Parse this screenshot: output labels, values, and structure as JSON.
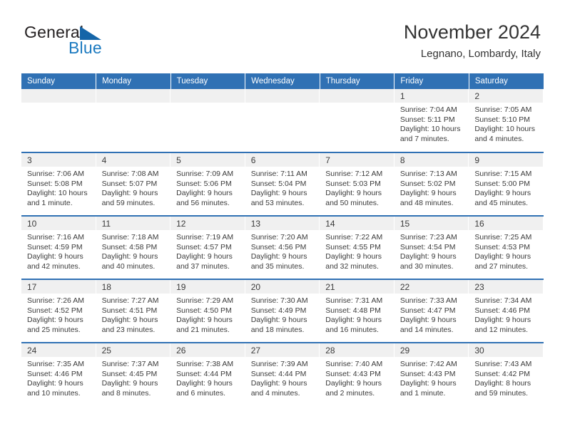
{
  "brand": {
    "name_part1": "General",
    "name_part2": "Blue",
    "triangle_icon": "triangle-icon",
    "accent_color": "#1565a8"
  },
  "header": {
    "title": "November 2024",
    "subtitle": "Legnano, Lombardy, Italy"
  },
  "theme": {
    "header_blue": "#3071b4",
    "daynum_band": "#f0f0f0",
    "text": "#3b3b3b"
  },
  "weekday_headers": [
    "Sunday",
    "Monday",
    "Tuesday",
    "Wednesday",
    "Thursday",
    "Friday",
    "Saturday"
  ],
  "weeks": [
    [
      {
        "day": "",
        "sunrise": "",
        "sunset": "",
        "daylight1": "",
        "daylight2": "",
        "empty": true
      },
      {
        "day": "",
        "sunrise": "",
        "sunset": "",
        "daylight1": "",
        "daylight2": "",
        "empty": true
      },
      {
        "day": "",
        "sunrise": "",
        "sunset": "",
        "daylight1": "",
        "daylight2": "",
        "empty": true
      },
      {
        "day": "",
        "sunrise": "",
        "sunset": "",
        "daylight1": "",
        "daylight2": "",
        "empty": true
      },
      {
        "day": "",
        "sunrise": "",
        "sunset": "",
        "daylight1": "",
        "daylight2": "",
        "empty": true
      },
      {
        "day": "1",
        "sunrise": "Sunrise: 7:04 AM",
        "sunset": "Sunset: 5:11 PM",
        "daylight1": "Daylight: 10 hours",
        "daylight2": "and 7 minutes."
      },
      {
        "day": "2",
        "sunrise": "Sunrise: 7:05 AM",
        "sunset": "Sunset: 5:10 PM",
        "daylight1": "Daylight: 10 hours",
        "daylight2": "and 4 minutes."
      }
    ],
    [
      {
        "day": "3",
        "sunrise": "Sunrise: 7:06 AM",
        "sunset": "Sunset: 5:08 PM",
        "daylight1": "Daylight: 10 hours",
        "daylight2": "and 1 minute."
      },
      {
        "day": "4",
        "sunrise": "Sunrise: 7:08 AM",
        "sunset": "Sunset: 5:07 PM",
        "daylight1": "Daylight: 9 hours",
        "daylight2": "and 59 minutes."
      },
      {
        "day": "5",
        "sunrise": "Sunrise: 7:09 AM",
        "sunset": "Sunset: 5:06 PM",
        "daylight1": "Daylight: 9 hours",
        "daylight2": "and 56 minutes."
      },
      {
        "day": "6",
        "sunrise": "Sunrise: 7:11 AM",
        "sunset": "Sunset: 5:04 PM",
        "daylight1": "Daylight: 9 hours",
        "daylight2": "and 53 minutes."
      },
      {
        "day": "7",
        "sunrise": "Sunrise: 7:12 AM",
        "sunset": "Sunset: 5:03 PM",
        "daylight1": "Daylight: 9 hours",
        "daylight2": "and 50 minutes."
      },
      {
        "day": "8",
        "sunrise": "Sunrise: 7:13 AM",
        "sunset": "Sunset: 5:02 PM",
        "daylight1": "Daylight: 9 hours",
        "daylight2": "and 48 minutes."
      },
      {
        "day": "9",
        "sunrise": "Sunrise: 7:15 AM",
        "sunset": "Sunset: 5:00 PM",
        "daylight1": "Daylight: 9 hours",
        "daylight2": "and 45 minutes."
      }
    ],
    [
      {
        "day": "10",
        "sunrise": "Sunrise: 7:16 AM",
        "sunset": "Sunset: 4:59 PM",
        "daylight1": "Daylight: 9 hours",
        "daylight2": "and 42 minutes."
      },
      {
        "day": "11",
        "sunrise": "Sunrise: 7:18 AM",
        "sunset": "Sunset: 4:58 PM",
        "daylight1": "Daylight: 9 hours",
        "daylight2": "and 40 minutes."
      },
      {
        "day": "12",
        "sunrise": "Sunrise: 7:19 AM",
        "sunset": "Sunset: 4:57 PM",
        "daylight1": "Daylight: 9 hours",
        "daylight2": "and 37 minutes."
      },
      {
        "day": "13",
        "sunrise": "Sunrise: 7:20 AM",
        "sunset": "Sunset: 4:56 PM",
        "daylight1": "Daylight: 9 hours",
        "daylight2": "and 35 minutes."
      },
      {
        "day": "14",
        "sunrise": "Sunrise: 7:22 AM",
        "sunset": "Sunset: 4:55 PM",
        "daylight1": "Daylight: 9 hours",
        "daylight2": "and 32 minutes."
      },
      {
        "day": "15",
        "sunrise": "Sunrise: 7:23 AM",
        "sunset": "Sunset: 4:54 PM",
        "daylight1": "Daylight: 9 hours",
        "daylight2": "and 30 minutes."
      },
      {
        "day": "16",
        "sunrise": "Sunrise: 7:25 AM",
        "sunset": "Sunset: 4:53 PM",
        "daylight1": "Daylight: 9 hours",
        "daylight2": "and 27 minutes."
      }
    ],
    [
      {
        "day": "17",
        "sunrise": "Sunrise: 7:26 AM",
        "sunset": "Sunset: 4:52 PM",
        "daylight1": "Daylight: 9 hours",
        "daylight2": "and 25 minutes."
      },
      {
        "day": "18",
        "sunrise": "Sunrise: 7:27 AM",
        "sunset": "Sunset: 4:51 PM",
        "daylight1": "Daylight: 9 hours",
        "daylight2": "and 23 minutes."
      },
      {
        "day": "19",
        "sunrise": "Sunrise: 7:29 AM",
        "sunset": "Sunset: 4:50 PM",
        "daylight1": "Daylight: 9 hours",
        "daylight2": "and 21 minutes."
      },
      {
        "day": "20",
        "sunrise": "Sunrise: 7:30 AM",
        "sunset": "Sunset: 4:49 PM",
        "daylight1": "Daylight: 9 hours",
        "daylight2": "and 18 minutes."
      },
      {
        "day": "21",
        "sunrise": "Sunrise: 7:31 AM",
        "sunset": "Sunset: 4:48 PM",
        "daylight1": "Daylight: 9 hours",
        "daylight2": "and 16 minutes."
      },
      {
        "day": "22",
        "sunrise": "Sunrise: 7:33 AM",
        "sunset": "Sunset: 4:47 PM",
        "daylight1": "Daylight: 9 hours",
        "daylight2": "and 14 minutes."
      },
      {
        "day": "23",
        "sunrise": "Sunrise: 7:34 AM",
        "sunset": "Sunset: 4:46 PM",
        "daylight1": "Daylight: 9 hours",
        "daylight2": "and 12 minutes."
      }
    ],
    [
      {
        "day": "24",
        "sunrise": "Sunrise: 7:35 AM",
        "sunset": "Sunset: 4:46 PM",
        "daylight1": "Daylight: 9 hours",
        "daylight2": "and 10 minutes."
      },
      {
        "day": "25",
        "sunrise": "Sunrise: 7:37 AM",
        "sunset": "Sunset: 4:45 PM",
        "daylight1": "Daylight: 9 hours",
        "daylight2": "and 8 minutes."
      },
      {
        "day": "26",
        "sunrise": "Sunrise: 7:38 AM",
        "sunset": "Sunset: 4:44 PM",
        "daylight1": "Daylight: 9 hours",
        "daylight2": "and 6 minutes."
      },
      {
        "day": "27",
        "sunrise": "Sunrise: 7:39 AM",
        "sunset": "Sunset: 4:44 PM",
        "daylight1": "Daylight: 9 hours",
        "daylight2": "and 4 minutes."
      },
      {
        "day": "28",
        "sunrise": "Sunrise: 7:40 AM",
        "sunset": "Sunset: 4:43 PM",
        "daylight1": "Daylight: 9 hours",
        "daylight2": "and 2 minutes."
      },
      {
        "day": "29",
        "sunrise": "Sunrise: 7:42 AM",
        "sunset": "Sunset: 4:43 PM",
        "daylight1": "Daylight: 9 hours",
        "daylight2": "and 1 minute."
      },
      {
        "day": "30",
        "sunrise": "Sunrise: 7:43 AM",
        "sunset": "Sunset: 4:42 PM",
        "daylight1": "Daylight: 8 hours",
        "daylight2": "and 59 minutes."
      }
    ]
  ]
}
